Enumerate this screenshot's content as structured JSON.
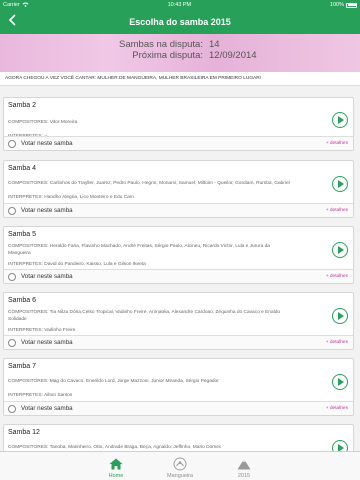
{
  "status": {
    "carrier": "Carrier",
    "time": "10:43 PM",
    "battery": "100%"
  },
  "nav": {
    "title": "Escolha do samba 2015"
  },
  "summary": {
    "count_label": "Sambas na disputa:",
    "count_value": "14",
    "next_label": "Próxima disputa:",
    "next_value": "12/09/2014"
  },
  "theme_text": "AGORA CHEGOU A VEZ VOCÊ CANTAR: MULHER DE MANGUEIRA, MULHER BRASILEIRA EM PRIMEIRO LUGAR!",
  "cards": [
    {
      "title": "Samba 2",
      "composers": "COMPOSITORES: Vitor Moreira",
      "performers": "INTERPRETES: --",
      "vote_label": "Votar neste samba",
      "details_label": "+ detalhes"
    },
    {
      "title": "Samba 4",
      "composers": "COMPOSITORES: Carlinhos do Trayller, Juarez, Pedro Paulo, Hegrin, Moriami, Samuel, Miltoim - Queilor, Gordiam, Rumba, Gabriel",
      "performers": "INTERPRETES: Handho Alegria, Lico Monteiro e Edu Cam",
      "vote_label": "Votar neste samba",
      "details_label": "+ detalhes"
    },
    {
      "title": "Samba 5",
      "composers": "COMPOSITORES: Heraldo Faria, Flavinho Machado, André Freitas, Sérgio Paulo, Alcineu, Ricardo Victor, Lula e Jurura da",
      "composers_cont": "Mangueira",
      "performers": "INTERPRETES: David do Pandeiro, Kaisso, Lula e Gilson Ikeeta",
      "vote_label": "Votar neste samba",
      "details_label": "+ detalhes"
    },
    {
      "title": "Samba 6",
      "composers": "COMPOSITORES: Tia Nilza Dória,Celso Tropical, Vadinho Freire, Arimatéia, Alexandre Cardoao, Zéquinha do Cavaco e Enaldo",
      "composers_cont": "Solidade",
      "performers": "INTERPRETES: Vadinho Freire",
      "vote_label": "Votar neste samba",
      "details_label": "+ detalhes"
    },
    {
      "title": "Samba 7",
      "composers": "COMPOSITORES: Mag do Cavaco, Enerildo Lord, Jorge Mazzoni, Junior Miranda, Sérgio Pegador",
      "performers": "INTERPRETES: Ailton Santos",
      "vote_label": "Votar neste samba",
      "details_label": "+ detalhes"
    },
    {
      "title": "Samba 12",
      "composers": "COMPOSITORES: Tanoba, Marinheiro, Otto, Andrade Braga, Beça, Agnaldo, Jeffinho, Mario Domec"
    }
  ],
  "tabs": [
    {
      "label": "Home",
      "icon": "home-icon",
      "active": true
    },
    {
      "label": "Mangueira",
      "icon": "mangueira-icon",
      "active": false
    },
    {
      "label": "2015",
      "icon": "mountain-icon",
      "active": false
    }
  ],
  "colors": {
    "accent": "#27a05a",
    "link": "#c0399a",
    "banner": "#e9b8dc"
  }
}
